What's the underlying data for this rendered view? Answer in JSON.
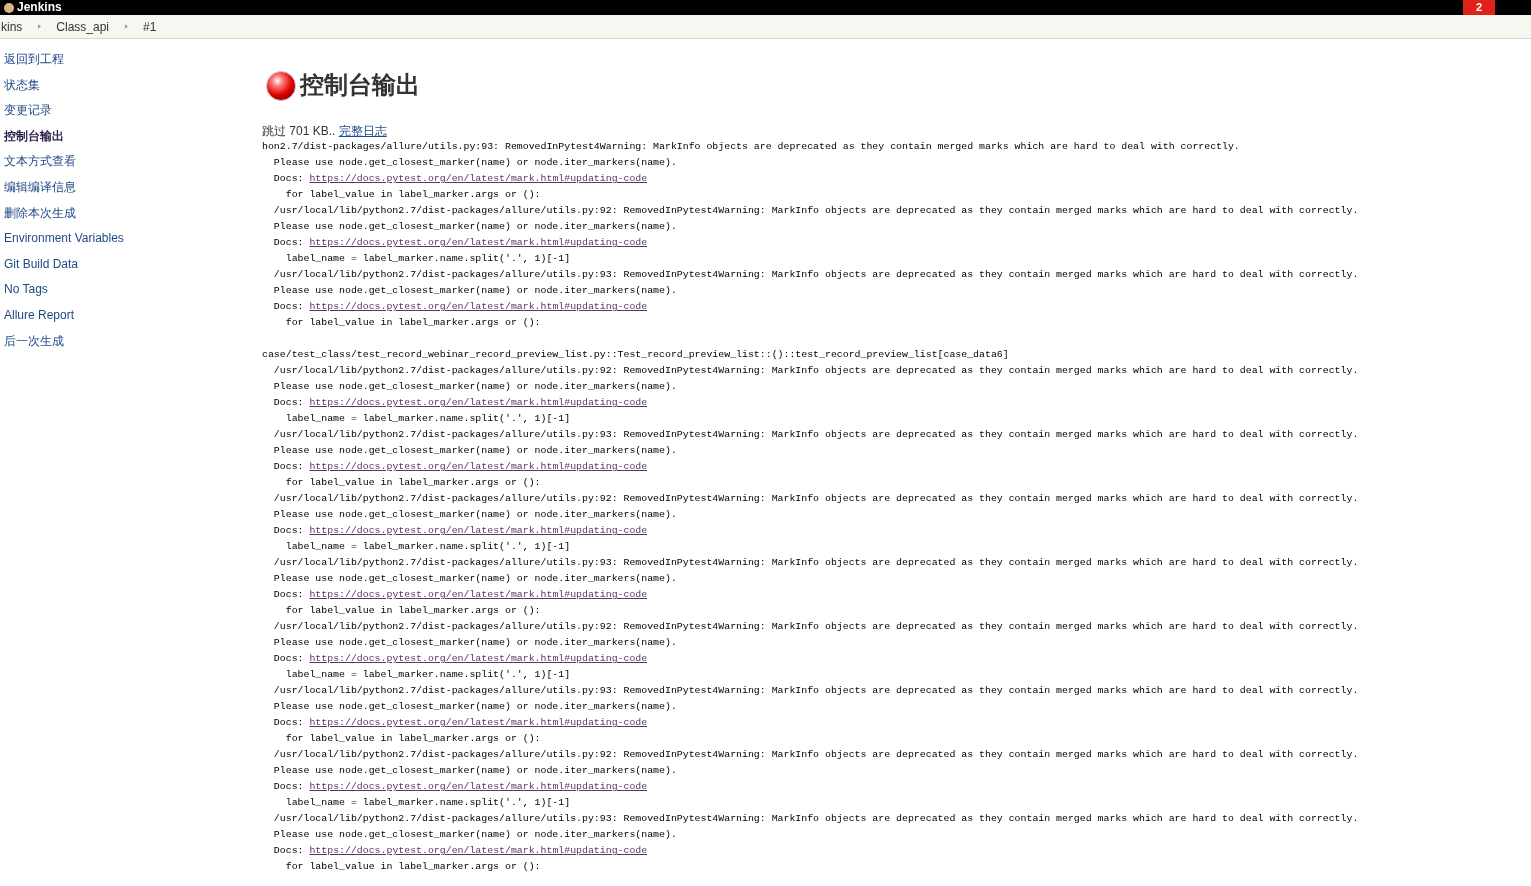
{
  "header": {
    "logo": "Jenkins",
    "badge": "2"
  },
  "breadcrumbs": [
    {
      "label": "kins"
    },
    {
      "label": "Class_api"
    },
    {
      "label": "#1"
    }
  ],
  "sidebar": {
    "items": [
      {
        "label": "返回到工程",
        "selected": false
      },
      {
        "label": "状态集",
        "selected": false
      },
      {
        "label": "变更记录",
        "selected": false
      },
      {
        "label": "控制台输出",
        "selected": true
      },
      {
        "label": "文本方式查看",
        "selected": false
      },
      {
        "label": "编辑编译信息",
        "selected": false
      },
      {
        "label": "删除本次生成",
        "selected": false
      },
      {
        "label": "Environment Variables",
        "selected": false
      },
      {
        "label": "Git Build Data",
        "selected": false
      },
      {
        "label": "No Tags",
        "selected": false
      },
      {
        "label": "Allure Report",
        "selected": false
      },
      {
        "label": "后一次生成",
        "selected": false
      }
    ]
  },
  "console": {
    "title": "控制台输出",
    "skipped": "跳过 701 KB.. ",
    "full_log_link": "完整日志",
    "lines": [
      {
        "kind": "text",
        "text": "hon2.7/dist-packages/allure/utils.py:93: RemovedInPytest4Warning: MarkInfo objects are deprecated as they contain merged marks which are hard to deal with correctly."
      },
      {
        "kind": "text",
        "text": "  Please use node.get_closest_marker(name) or node.iter_markers(name)."
      },
      {
        "kind": "docs",
        "text": "  Docs: ",
        "link": "https://docs.pytest.org/en/latest/mark.html#updating-code"
      },
      {
        "kind": "text",
        "text": "    for label_value in label_marker.args or ():"
      },
      {
        "kind": "text",
        "text": "  /usr/local/lib/python2.7/dist-packages/allure/utils.py:92: RemovedInPytest4Warning: MarkInfo objects are deprecated as they contain merged marks which are hard to deal with correctly."
      },
      {
        "kind": "text",
        "text": "  Please use node.get_closest_marker(name) or node.iter_markers(name)."
      },
      {
        "kind": "docs",
        "text": "  Docs: ",
        "link": "https://docs.pytest.org/en/latest/mark.html#updating-code"
      },
      {
        "kind": "text",
        "text": "    label_name = label_marker.name.split('.', 1)[-1]"
      },
      {
        "kind": "text",
        "text": "  /usr/local/lib/python2.7/dist-packages/allure/utils.py:93: RemovedInPytest4Warning: MarkInfo objects are deprecated as they contain merged marks which are hard to deal with correctly."
      },
      {
        "kind": "text",
        "text": "  Please use node.get_closest_marker(name) or node.iter_markers(name)."
      },
      {
        "kind": "docs",
        "text": "  Docs: ",
        "link": "https://docs.pytest.org/en/latest/mark.html#updating-code"
      },
      {
        "kind": "text",
        "text": "    for label_value in label_marker.args or ():"
      },
      {
        "kind": "blank"
      },
      {
        "kind": "text",
        "text": "case/test_class/test_record_webinar_record_preview_list.py::Test_record_preview_list::()::test_record_preview_list[case_data6]"
      },
      {
        "kind": "text",
        "text": "  /usr/local/lib/python2.7/dist-packages/allure/utils.py:92: RemovedInPytest4Warning: MarkInfo objects are deprecated as they contain merged marks which are hard to deal with correctly."
      },
      {
        "kind": "text",
        "text": "  Please use node.get_closest_marker(name) or node.iter_markers(name)."
      },
      {
        "kind": "docs",
        "text": "  Docs: ",
        "link": "https://docs.pytest.org/en/latest/mark.html#updating-code"
      },
      {
        "kind": "text",
        "text": "    label_name = label_marker.name.split('.', 1)[-1]"
      },
      {
        "kind": "text",
        "text": "  /usr/local/lib/python2.7/dist-packages/allure/utils.py:93: RemovedInPytest4Warning: MarkInfo objects are deprecated as they contain merged marks which are hard to deal with correctly."
      },
      {
        "kind": "text",
        "text": "  Please use node.get_closest_marker(name) or node.iter_markers(name)."
      },
      {
        "kind": "docs",
        "text": "  Docs: ",
        "link": "https://docs.pytest.org/en/latest/mark.html#updating-code"
      },
      {
        "kind": "text",
        "text": "    for label_value in label_marker.args or ():"
      },
      {
        "kind": "text",
        "text": "  /usr/local/lib/python2.7/dist-packages/allure/utils.py:92: RemovedInPytest4Warning: MarkInfo objects are deprecated as they contain merged marks which are hard to deal with correctly."
      },
      {
        "kind": "text",
        "text": "  Please use node.get_closest_marker(name) or node.iter_markers(name)."
      },
      {
        "kind": "docs",
        "text": "  Docs: ",
        "link": "https://docs.pytest.org/en/latest/mark.html#updating-code"
      },
      {
        "kind": "text",
        "text": "    label_name = label_marker.name.split('.', 1)[-1]"
      },
      {
        "kind": "text",
        "text": "  /usr/local/lib/python2.7/dist-packages/allure/utils.py:93: RemovedInPytest4Warning: MarkInfo objects are deprecated as they contain merged marks which are hard to deal with correctly."
      },
      {
        "kind": "text",
        "text": "  Please use node.get_closest_marker(name) or node.iter_markers(name)."
      },
      {
        "kind": "docs",
        "text": "  Docs: ",
        "link": "https://docs.pytest.org/en/latest/mark.html#updating-code"
      },
      {
        "kind": "text",
        "text": "    for label_value in label_marker.args or ():"
      },
      {
        "kind": "text",
        "text": "  /usr/local/lib/python2.7/dist-packages/allure/utils.py:92: RemovedInPytest4Warning: MarkInfo objects are deprecated as they contain merged marks which are hard to deal with correctly."
      },
      {
        "kind": "text",
        "text": "  Please use node.get_closest_marker(name) or node.iter_markers(name)."
      },
      {
        "kind": "docs",
        "text": "  Docs: ",
        "link": "https://docs.pytest.org/en/latest/mark.html#updating-code"
      },
      {
        "kind": "text",
        "text": "    label_name = label_marker.name.split('.', 1)[-1]"
      },
      {
        "kind": "text",
        "text": "  /usr/local/lib/python2.7/dist-packages/allure/utils.py:93: RemovedInPytest4Warning: MarkInfo objects are deprecated as they contain merged marks which are hard to deal with correctly."
      },
      {
        "kind": "text",
        "text": "  Please use node.get_closest_marker(name) or node.iter_markers(name)."
      },
      {
        "kind": "docs",
        "text": "  Docs: ",
        "link": "https://docs.pytest.org/en/latest/mark.html#updating-code"
      },
      {
        "kind": "text",
        "text": "    for label_value in label_marker.args or ():"
      },
      {
        "kind": "text",
        "text": "  /usr/local/lib/python2.7/dist-packages/allure/utils.py:92: RemovedInPytest4Warning: MarkInfo objects are deprecated as they contain merged marks which are hard to deal with correctly."
      },
      {
        "kind": "text",
        "text": "  Please use node.get_closest_marker(name) or node.iter_markers(name)."
      },
      {
        "kind": "docs",
        "text": "  Docs: ",
        "link": "https://docs.pytest.org/en/latest/mark.html#updating-code"
      },
      {
        "kind": "text",
        "text": "    label_name = label_marker.name.split('.', 1)[-1]"
      },
      {
        "kind": "text",
        "text": "  /usr/local/lib/python2.7/dist-packages/allure/utils.py:93: RemovedInPytest4Warning: MarkInfo objects are deprecated as they contain merged marks which are hard to deal with correctly."
      },
      {
        "kind": "text",
        "text": "  Please use node.get_closest_marker(name) or node.iter_markers(name)."
      },
      {
        "kind": "docs",
        "text": "  Docs: ",
        "link": "https://docs.pytest.org/en/latest/mark.html#updating-code"
      },
      {
        "kind": "text",
        "text": "    for label_value in label_marker.args or ():"
      }
    ]
  }
}
